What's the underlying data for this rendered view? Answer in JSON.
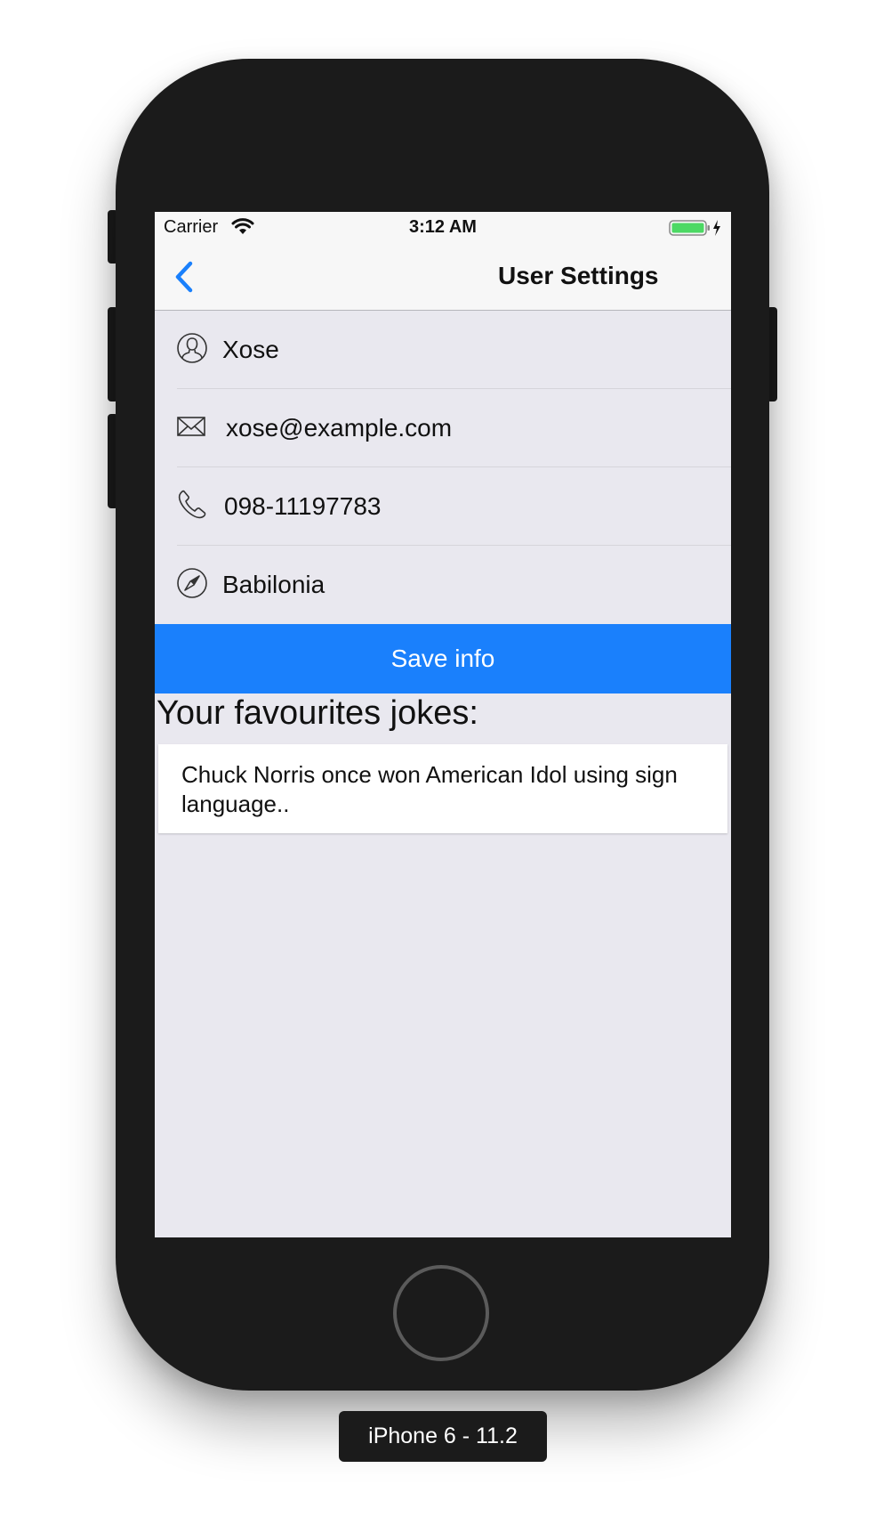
{
  "status_bar": {
    "carrier": "Carrier",
    "time": "3:12 AM"
  },
  "nav": {
    "title": "User Settings"
  },
  "form": {
    "name": "Xose",
    "email": "xose@example.com",
    "phone": "098-11197783",
    "location": "Babilonia"
  },
  "save_label": "Save info",
  "jokes": {
    "heading": "Your favourites jokes:",
    "items": [
      "Chuck Norris once won American Idol using sign language.."
    ]
  },
  "device_label": "iPhone 6 - 11.2",
  "colors": {
    "accent": "#1a80fc",
    "screen_bg": "#e9e8ef",
    "bar_bg": "#f7f7f7",
    "phone_body": "#1b1b1b",
    "battery": "#4cd964"
  },
  "icons": {
    "back": "chevron-left-icon",
    "name": "user-icon",
    "email": "envelope-icon",
    "phone": "phone-icon",
    "location": "compass-icon"
  }
}
